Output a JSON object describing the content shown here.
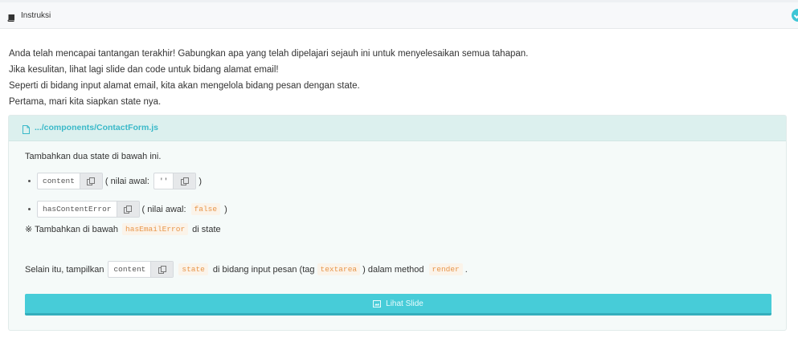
{
  "header": {
    "title": "Instruksi",
    "icon": "book-icon",
    "status_icon": "check-circle-icon",
    "accent": "#3ec6d6"
  },
  "intro": [
    "Anda telah mencapai tantangan terakhir! Gabungkan apa yang telah dipelajari sejauh ini untuk menyelesaikan semua tahapan.",
    "Jika kesulitan, lihat lagi slide dan code untuk bidang alamat email!",
    "Seperti di bidang input alamat email, kita akan mengelola bidang pesan dengan state.",
    "Pertama, mari kita siapkan state nya."
  ],
  "card": {
    "file_path": ".../components/ContactForm.js",
    "instruction": "Tambahkan dua state di bawah ini.",
    "state1": {
      "name": "content",
      "paren_open": "( nilai awal:",
      "initial": "''",
      "paren_close": ")"
    },
    "state2": {
      "name": "hasContentError",
      "paren_open": "( nilai awal:",
      "initial": "false",
      "paren_close": ")"
    },
    "note": {
      "prefix": "※ Tambahkan di bawah",
      "code": "hasEmailError",
      "suffix": "di state"
    },
    "display": {
      "prefix": "Selain itu, tampilkan",
      "chip": "content",
      "code1": "state",
      "mid": "di bidang input pesan (tag",
      "code2": "textarea",
      "mid2": ") dalam method",
      "code3": "render",
      "end": "."
    },
    "slide_button": "Lihat Slide"
  }
}
